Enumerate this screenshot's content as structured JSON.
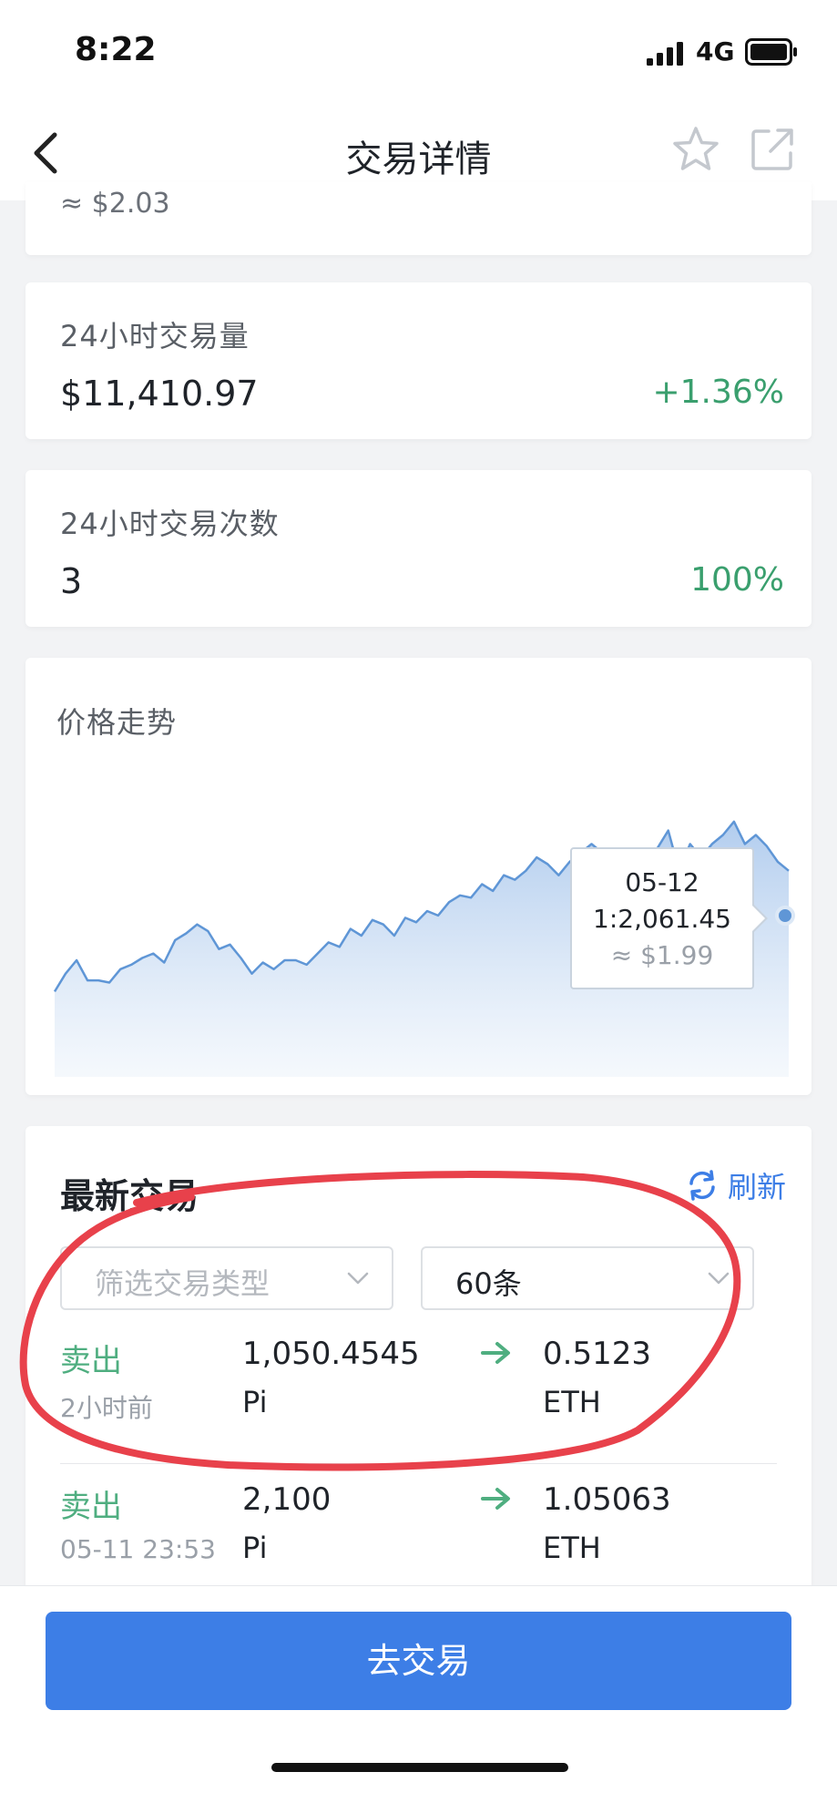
{
  "status_bar": {
    "time": "8:22",
    "network": "4G"
  },
  "header": {
    "title": "交易详情"
  },
  "top_card": {
    "approx_price": "≈ $2.03"
  },
  "volume_card": {
    "label": "24小时交易量",
    "value": "$11,410.97",
    "change": "+1.36%"
  },
  "count_card": {
    "label": "24小时交易次数",
    "value": "3",
    "change": "100%"
  },
  "chart": {
    "title": "价格走势",
    "tooltip": {
      "date": "05-12",
      "rate": "1:2,061.45",
      "usd": "≈ $1.99"
    }
  },
  "chart_data": {
    "type": "area",
    "values": [
      30,
      38,
      44,
      35,
      35,
      34,
      40,
      42,
      45,
      47,
      43,
      53,
      56,
      60,
      57,
      49,
      51,
      45,
      38,
      43,
      40,
      44,
      44,
      42,
      47,
      52,
      50,
      58,
      55,
      62,
      60,
      55,
      63,
      61,
      66,
      64,
      70,
      73,
      72,
      78,
      75,
      82,
      80,
      84,
      90,
      87,
      82,
      88,
      92,
      96,
      92,
      84,
      85,
      80,
      88,
      94,
      102,
      84,
      96,
      90,
      96,
      100,
      106,
      96,
      100,
      95,
      88,
      84
    ],
    "color": "#5f96d6",
    "fill": "#cfe0f4"
  },
  "trades": {
    "title": "最新交易",
    "refresh_label": "刷新",
    "filter_type_placeholder": "筛选交易类型",
    "filter_count_value": "60条",
    "rows": [
      {
        "side": "卖出",
        "time": "2小时前",
        "amount": "1,050.4545",
        "amount_unit": "Pi",
        "receive": "0.5123",
        "receive_unit": "ETH"
      },
      {
        "side": "卖出",
        "time": "05-11 23:53",
        "amount": "2,100",
        "amount_unit": "Pi",
        "receive": "1.05063",
        "receive_unit": "ETH"
      }
    ]
  },
  "footer": {
    "button_label": "去交易"
  },
  "colors": {
    "accent": "#3d7ee6",
    "positive": "#3a9f6e",
    "annotation": "#e8414b"
  },
  "icons": [
    "back-icon",
    "star-icon",
    "share-icon",
    "refresh-icon",
    "chevron-down-icon",
    "arrow-right-icon"
  ]
}
